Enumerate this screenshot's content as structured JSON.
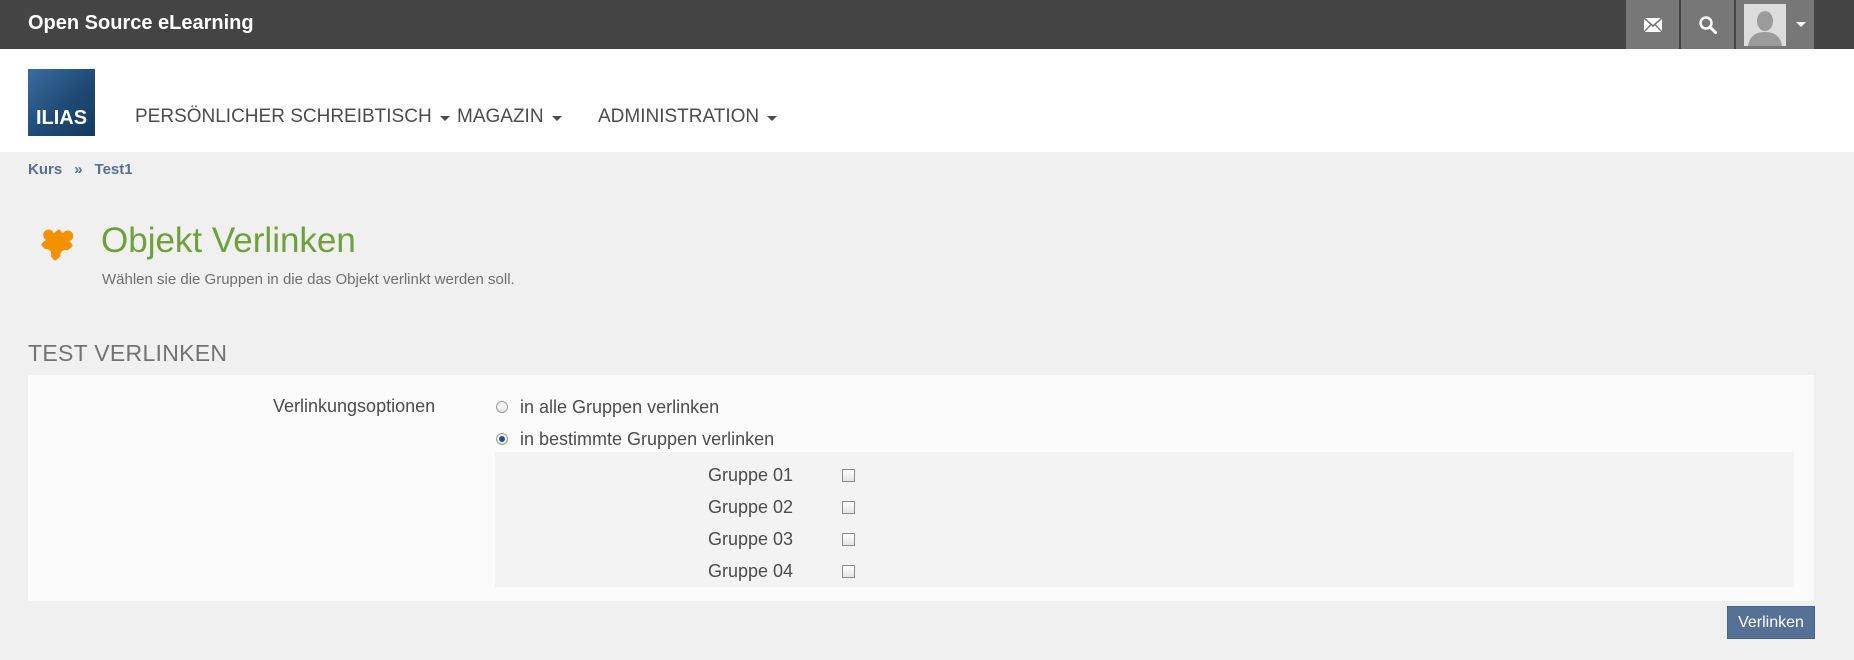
{
  "topbar": {
    "brand": "Open Source eLearning",
    "icons": {
      "mail": "mail-icon",
      "search": "search-icon",
      "user": "avatar-icon"
    }
  },
  "header": {
    "logo_text": "ILIAS",
    "nav": [
      {
        "label": "PERSÖNLICHER SCHREIBTISCH"
      },
      {
        "label": "MAGAZIN"
      },
      {
        "label": "ADMINISTRATION"
      }
    ]
  },
  "breadcrumb": {
    "items": [
      "Kurs",
      "Test1"
    ],
    "separator": "»"
  },
  "page": {
    "icon": "puzzle-icon",
    "title": "Objekt Verlinken",
    "description": "Wählen sie die Gruppen in die das Objekt verlinkt werden soll."
  },
  "form": {
    "title": "TEST VERLINKEN",
    "field_label": "Verlinkungsoptionen",
    "options": [
      {
        "label": "in alle Gruppen verlinken",
        "checked": false
      },
      {
        "label": "in bestimmte Gruppen verlinken",
        "checked": true
      }
    ],
    "groups": [
      {
        "label": "Gruppe 01",
        "checked": false
      },
      {
        "label": "Gruppe 02",
        "checked": false
      },
      {
        "label": "Gruppe 03",
        "checked": false
      },
      {
        "label": "Gruppe 04",
        "checked": false
      }
    ],
    "submit_label": "Verlinken"
  },
  "colors": {
    "topbar": "#444444",
    "accent_title": "#6ea03c",
    "link": "#557196",
    "button": "#557196",
    "icon_orange": "#f39200"
  }
}
